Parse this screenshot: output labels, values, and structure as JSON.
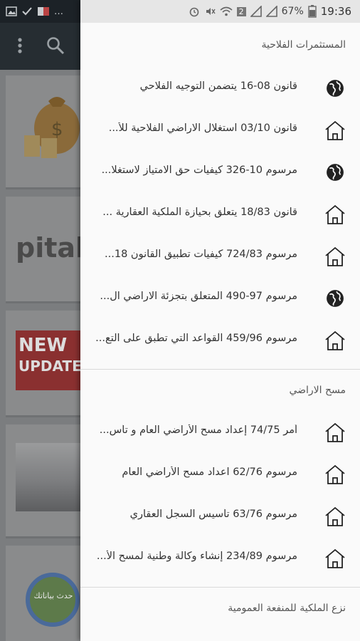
{
  "status_bar": {
    "left_icons": [
      "image-icon",
      "check-icon",
      "dz-icon",
      "more-dots"
    ],
    "signal_text": "2",
    "battery": "67%",
    "time": "19:36"
  },
  "background_app": {
    "toolbar_icons": [
      "more-vert-icon",
      "search-icon"
    ],
    "cards": [
      "money-bag",
      "capital",
      "news-update",
      "airport",
      "update-data"
    ],
    "card_text_new": "NEW",
    "card_text_update": "UPDATE",
    "card_text_update_data": "حدث بياناتك"
  },
  "drawer": {
    "sections": [
      {
        "title": "المستثمرات الفلاحية",
        "items": [
          {
            "label": "قانون 08-16 يتضمن التوجيه  الفلاحي",
            "icon": "globe-icon"
          },
          {
            "label": "قانون 03/10 استغلال الاراضي الفلاحية للأ...",
            "icon": "home-icon"
          },
          {
            "label": "مرسوم 10-326 كيفيات حق الامتياز لاستغلا...",
            "icon": "globe-icon"
          },
          {
            "label": "قانون 18/83 يتعلق بحيازة الملكية العقارية ...",
            "icon": "home-icon"
          },
          {
            "label": "مرسوم 724/83  كيفيات تطبيق القانون 18...",
            "icon": "home-icon"
          },
          {
            "label": "مرسوم 97-490 المتعلق بتجزئة الاراضي ال...",
            "icon": "globe-icon"
          },
          {
            "label": "مرسوم 459/96 القواعد التي تطبق على التع...",
            "icon": "home-icon"
          }
        ]
      },
      {
        "title": "مسح الاراضي",
        "items": [
          {
            "label": "أمر 74/75 إعداد مسح الأراضي العام و تأس...",
            "icon": "home-icon"
          },
          {
            "label": "مرسوم 62/76 اعداد مسح الأراضي العام",
            "icon": "home-icon"
          },
          {
            "label": "مرسوم 63/76 تأسيس السجل العقاري",
            "icon": "home-icon"
          },
          {
            "label": "مرسوم 234/89 إنشاء وكالة وطنية لمسح الأ...",
            "icon": "home-icon"
          }
        ]
      },
      {
        "title": "نزع الملكية للمنفعة العمومية",
        "items": []
      }
    ]
  },
  "colors": {
    "drawer_bg": "#fafafa",
    "toolbar_bg": "#262d32",
    "text": "#333333",
    "icon": "#222222"
  }
}
